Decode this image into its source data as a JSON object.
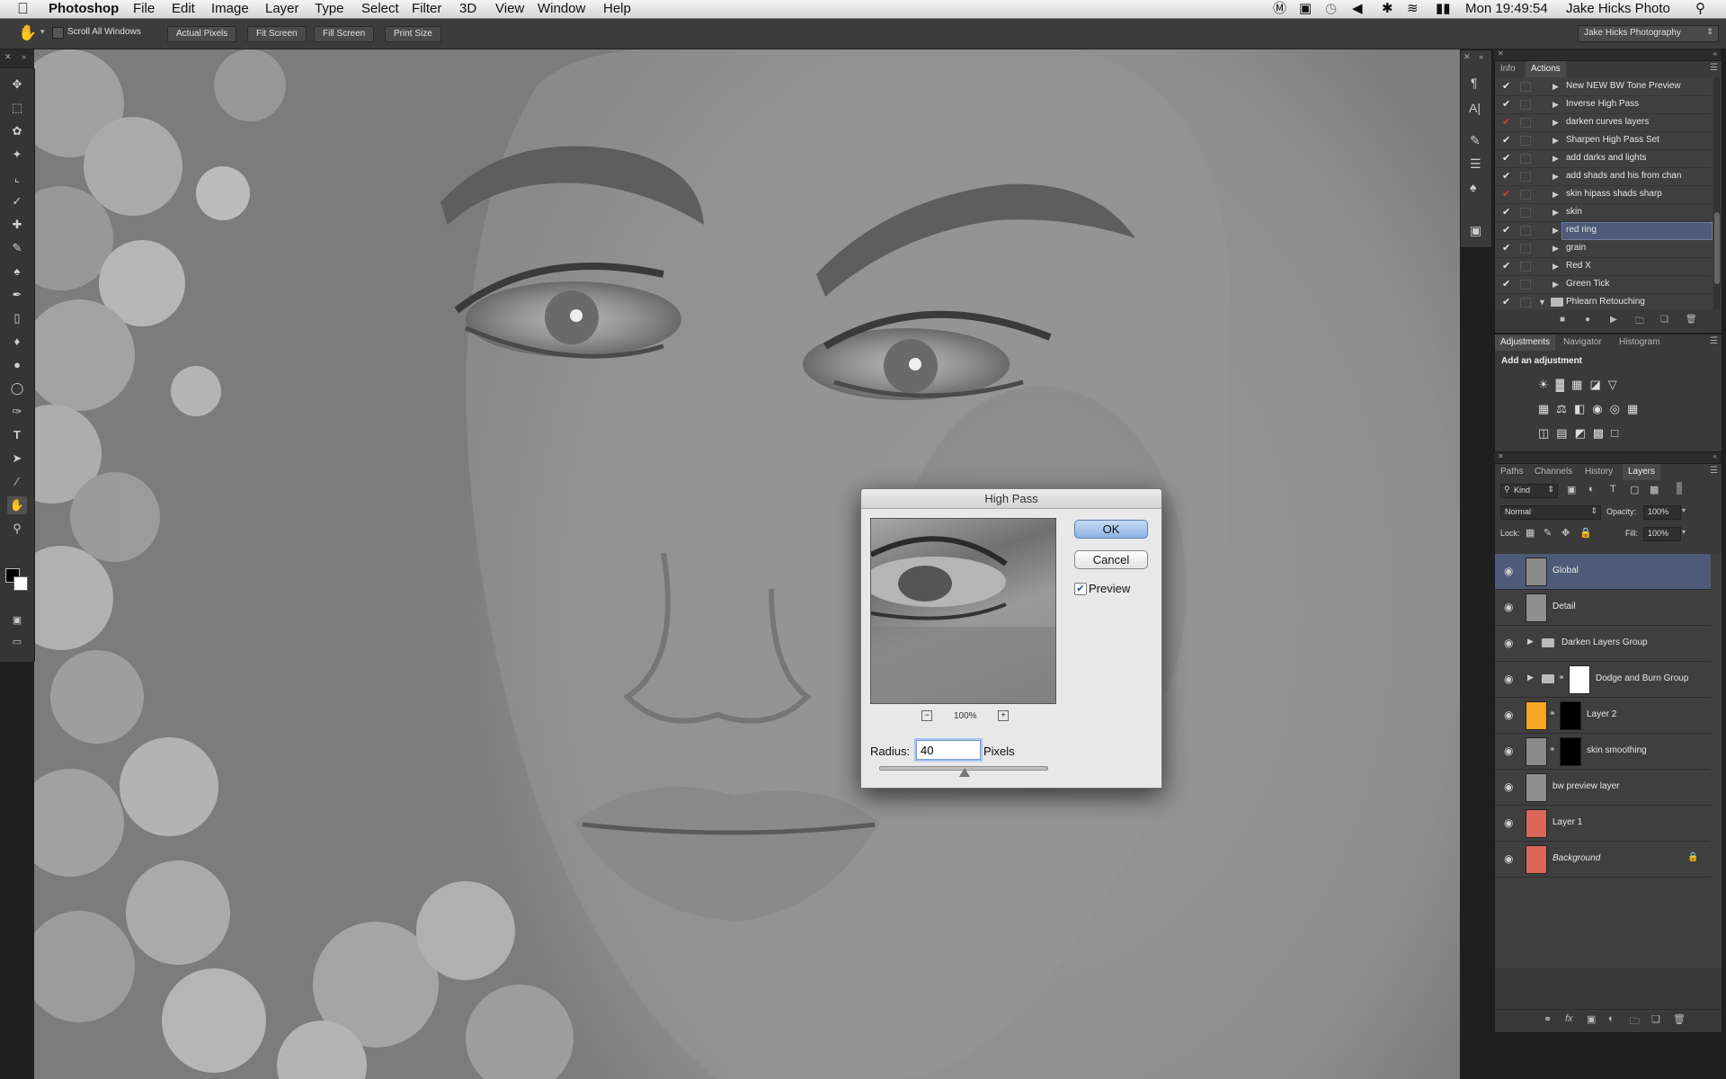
{
  "menubar": {
    "app": "Photoshop",
    "items": [
      "File",
      "Edit",
      "Image",
      "Layer",
      "Type",
      "Select",
      "Filter",
      "3D",
      "View",
      "Window",
      "Help"
    ],
    "clock": "Mon 19:49:54",
    "user": "Jake Hicks Photo"
  },
  "options_bar": {
    "scroll_all_windows": "Scroll All Windows",
    "actual_pixels": "Actual Pixels",
    "fit_screen": "Fit Screen",
    "fill_screen": "Fill Screen",
    "print_size": "Print Size",
    "workspace": "Jake Hicks Photography"
  },
  "actions_panel": {
    "tabs": [
      "Info",
      "Actions"
    ],
    "items": [
      {
        "name": "New NEW BW Tone Preview",
        "check": "#e6e6e6"
      },
      {
        "name": "Inverse High Pass",
        "check": "#e6e6e6"
      },
      {
        "name": "darken curves layers",
        "check": "#d83a3a"
      },
      {
        "name": "Sharpen High Pass Set",
        "check": "#e6e6e6"
      },
      {
        "name": "add darks and lights",
        "check": "#e6e6e6"
      },
      {
        "name": "add shads and his from chan",
        "check": "#e6e6e6"
      },
      {
        "name": "skin hipass shads sharp",
        "check": "#d83a3a"
      },
      {
        "name": "skin",
        "check": "#e6e6e6"
      },
      {
        "name": "red ring",
        "check": "#e6e6e6"
      },
      {
        "name": "grain",
        "check": "#e6e6e6"
      },
      {
        "name": "Red X",
        "check": "#e6e6e6"
      },
      {
        "name": "Green Tick",
        "check": "#e6e6e6"
      },
      {
        "name": "Phlearn Retouching",
        "check": "#e6e6e6"
      }
    ],
    "selected_index": 8
  },
  "adjustments_panel": {
    "tabs": [
      "Adjustments",
      "Navigator",
      "Histogram"
    ],
    "heading": "Add an adjustment"
  },
  "layers_panel": {
    "tabs": [
      "Paths",
      "Channels",
      "History",
      "Layers"
    ],
    "filter": "Kind",
    "blend_mode": "Normal",
    "opacity_label": "Opacity:",
    "opacity": "100%",
    "lock_label": "Lock:",
    "fill_label": "Fill:",
    "fill": "100%",
    "layers": [
      {
        "name": "Global",
        "thumb": "#8a8a8a",
        "mask": "",
        "group": false,
        "selected": true,
        "italic": false,
        "locked": false
      },
      {
        "name": "Detail",
        "thumb": "#8f8f8f",
        "mask": "",
        "group": false,
        "selected": false,
        "italic": false,
        "locked": false
      },
      {
        "name": "Darken Layers Group",
        "thumb": "",
        "mask": "",
        "group": true,
        "selected": false,
        "italic": false,
        "locked": false
      },
      {
        "name": "Dodge and Burn Group",
        "thumb": "",
        "mask": "#ffffff",
        "group": true,
        "selected": false,
        "italic": false,
        "locked": false
      },
      {
        "name": "Layer 2",
        "thumb": "#f5a623",
        "mask": "#000000",
        "group": false,
        "selected": false,
        "italic": false,
        "locked": false
      },
      {
        "name": "skin smoothing",
        "thumb": "#8a8a8a",
        "mask": "#000000",
        "group": false,
        "selected": false,
        "italic": false,
        "locked": false
      },
      {
        "name": "bw preview layer",
        "thumb": "#8f8f8f",
        "mask": "",
        "group": false,
        "selected": false,
        "italic": false,
        "locked": false
      },
      {
        "name": "Layer 1",
        "thumb": "#d9685a",
        "mask": "",
        "group": false,
        "selected": false,
        "italic": false,
        "locked": false
      },
      {
        "name": "Background",
        "thumb": "#d9685a",
        "mask": "",
        "group": false,
        "selected": false,
        "italic": true,
        "locked": true
      }
    ]
  },
  "dialog": {
    "title": "High Pass",
    "ok": "OK",
    "cancel": "Cancel",
    "preview_label": "Preview",
    "preview_checked": true,
    "zoom": "100%",
    "radius_label": "Radius:",
    "radius_value": "40",
    "unit": "Pixels",
    "slider_fraction": 0.51
  }
}
